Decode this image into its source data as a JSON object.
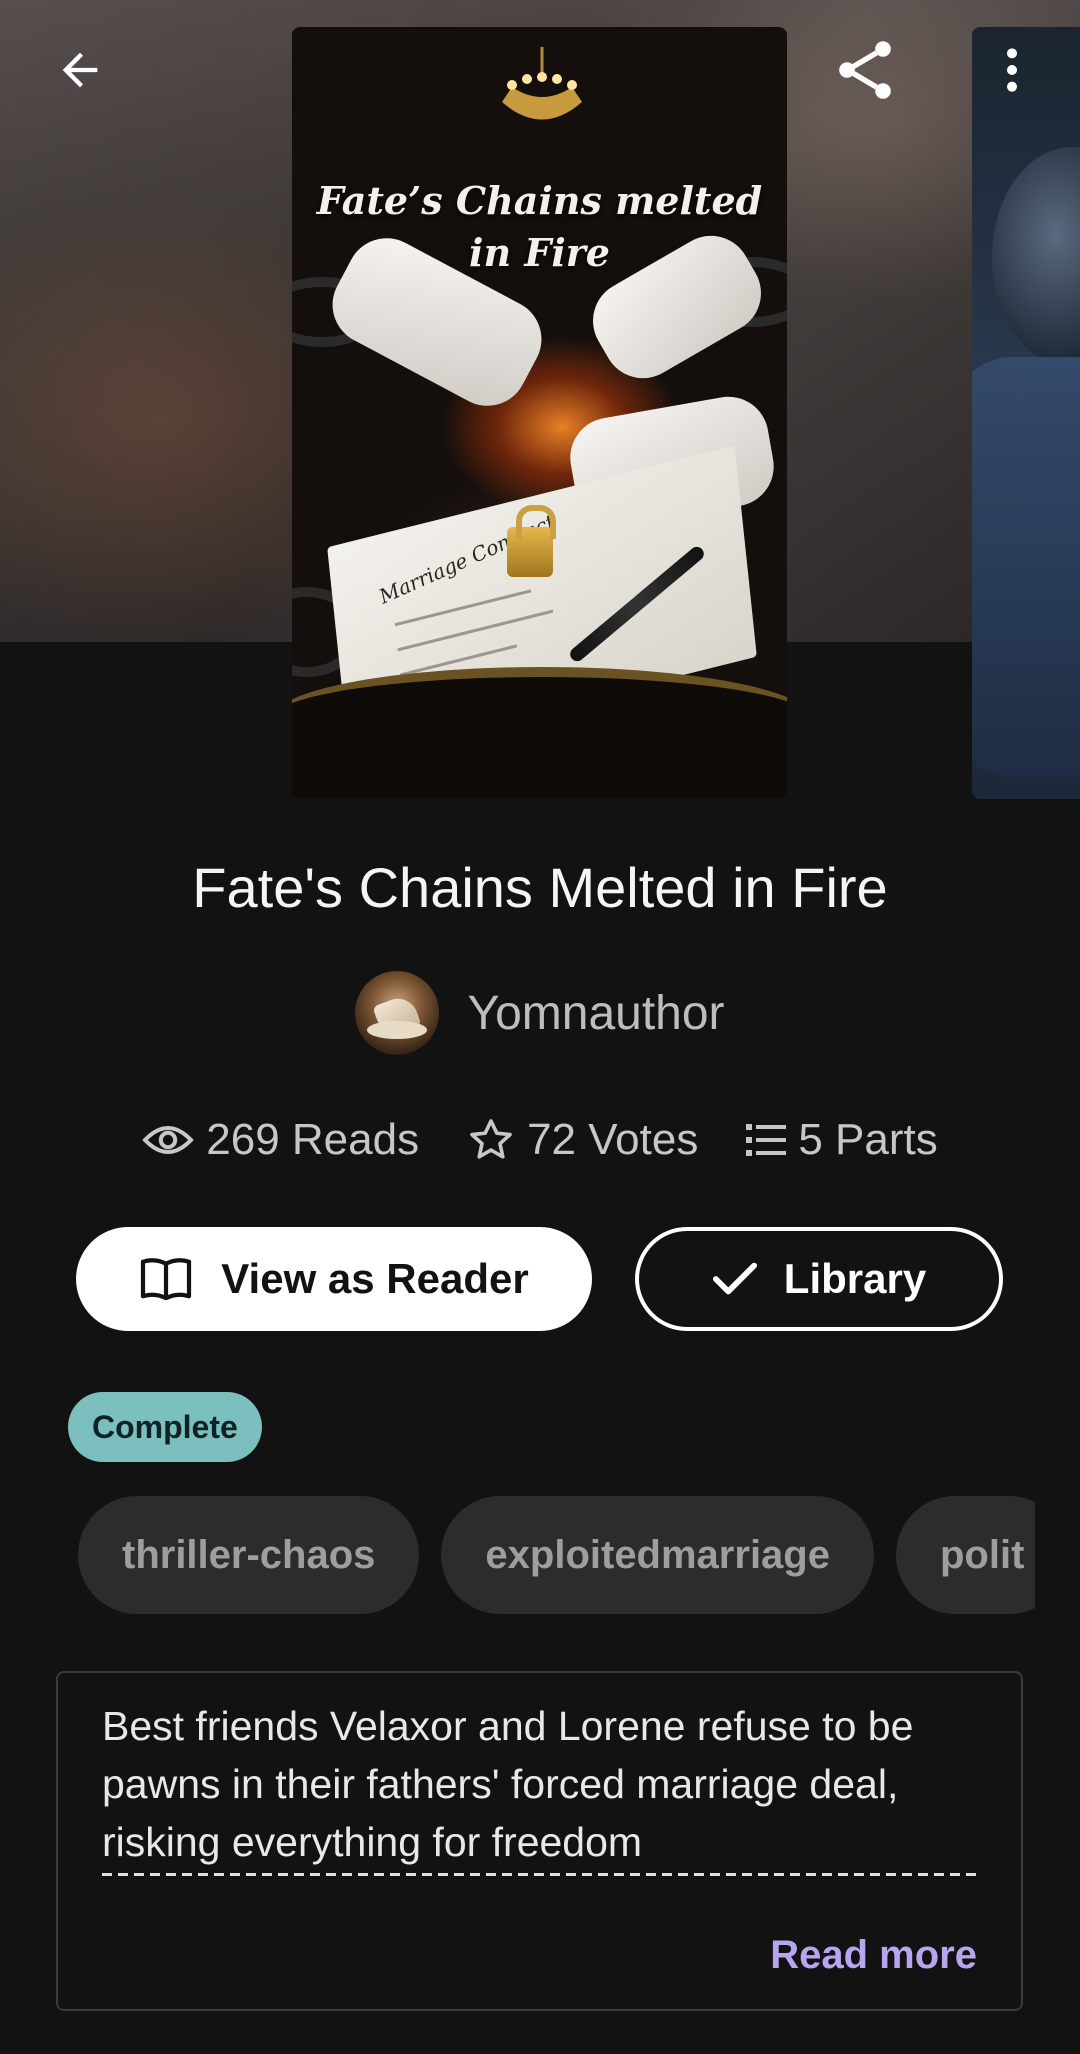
{
  "book": {
    "title": "Fate's Chains Melted in Fire",
    "cover_title": "Fate’s Chains melted in Fire",
    "cover_contract_label": "Marriage Contract",
    "author": "Yomnauthor",
    "status": "Complete",
    "description": "Best friends Velaxor and Lorene refuse to be pawns in their fathers' forced marriage deal, risking everything for freedom",
    "read_more_label": "Read more"
  },
  "stats": {
    "reads": "269 Reads",
    "votes": "72 Votes",
    "parts": "5 Parts"
  },
  "actions": {
    "view_as_reader": "View as Reader",
    "library": "Library"
  },
  "tags": [
    "thriller-chaos",
    "exploitedmarriage",
    "polit"
  ],
  "icons": {
    "back": "arrow-left-icon",
    "share": "share-icon",
    "more": "more-vertical-icon",
    "reads": "eye-icon",
    "votes": "star-outline-icon",
    "parts": "list-icon",
    "reader": "open-book-icon",
    "library": "check-icon"
  },
  "colors": {
    "background": "#121212",
    "status_badge": "#7cbfbf",
    "read_more": "#b7a6ee",
    "tag_bg": "#2c2c2c"
  }
}
